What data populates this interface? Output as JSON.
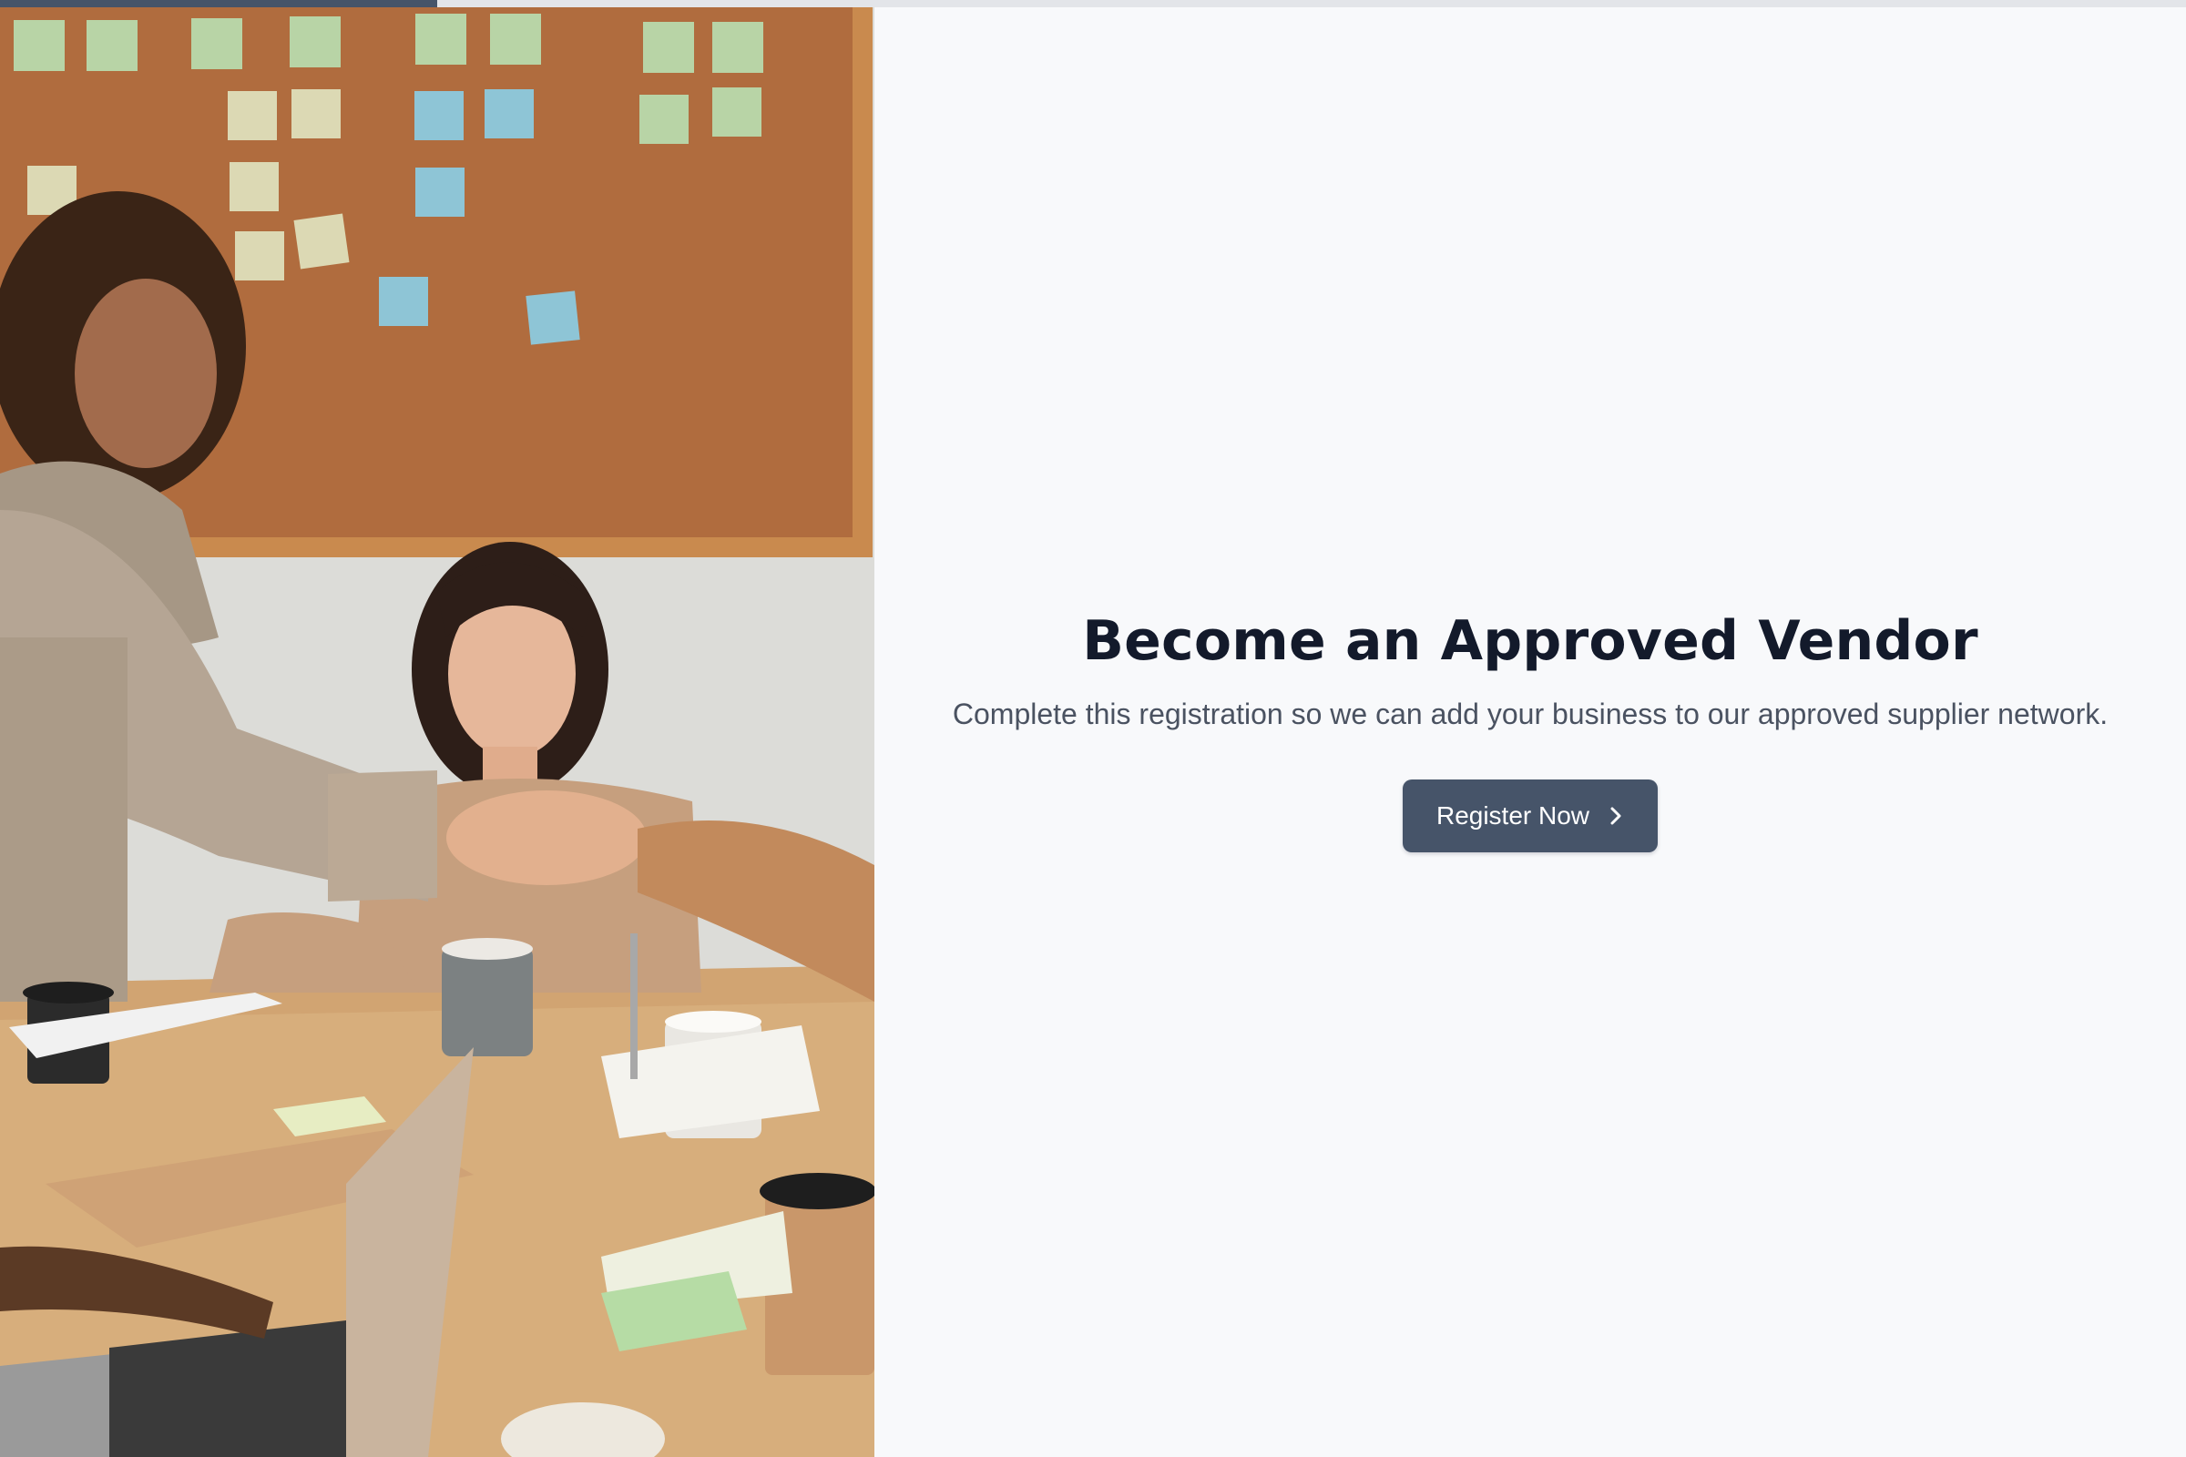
{
  "progress": {
    "value": 0.2
  },
  "hero_image": {
    "icon": "office-meeting-handshake-photo"
  },
  "main": {
    "title": "Become an Approved Vendor",
    "subtitle": "Complete this registration so we can add your business to our approved supplier network.",
    "cta_label": "Register Now",
    "cta_icon": "chevron-right-icon"
  },
  "colors": {
    "accent": "#465469",
    "title": "#131a2b",
    "text": "#4a5261",
    "background": "#f8f9fb",
    "progress_track": "#e3e5e9"
  }
}
